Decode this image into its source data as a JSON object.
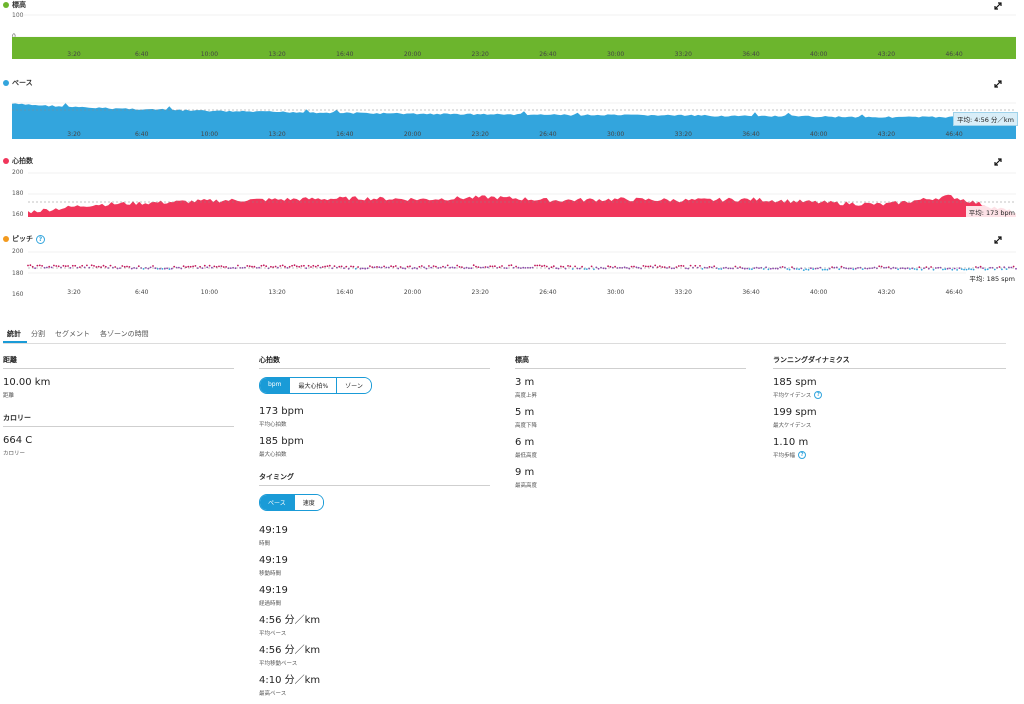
{
  "charts": {
    "elevation": {
      "title": "標高",
      "color": "#6cb52d",
      "yticks": [
        "100",
        "0"
      ]
    },
    "pace": {
      "title": "ペース",
      "color": "#33a5dd",
      "avg_label": "平均: 4:56 分／km"
    },
    "heart_rate": {
      "title": "心拍数",
      "color": "#f0365b",
      "yticks": [
        "200",
        "180",
        "160"
      ],
      "avg_label": "平均: 173 bpm"
    },
    "cadence": {
      "title": "ピッチ",
      "color": "#f39a1e",
      "help": "?",
      "yticks": [
        "200",
        "180",
        "160"
      ],
      "avg_label": "平均: 185 spm"
    },
    "x_ticks": [
      "3:20",
      "6:40",
      "10:00",
      "13:20",
      "16:40",
      "20:00",
      "23:20",
      "26:40",
      "30:00",
      "33:20",
      "36:40",
      "40:00",
      "43:20",
      "46:40"
    ]
  },
  "chart_data": [
    {
      "type": "area",
      "title": "標高",
      "x_unit": "elapsed time",
      "ylim": [
        0,
        100
      ],
      "series": [
        {
          "name": "標高",
          "values": [
            6,
            6,
            6,
            6,
            6,
            6,
            6,
            6,
            6,
            6,
            6,
            6,
            6,
            6,
            6
          ]
        }
      ]
    },
    {
      "type": "area",
      "title": "ペース",
      "average": "4:56 分／km",
      "series": [
        {
          "name": "ペース",
          "values": [
            4.7,
            4.8,
            4.85,
            4.9,
            4.92,
            4.95,
            4.97,
            4.98,
            5.0,
            5.0,
            5.02,
            5.03,
            5.05,
            5.05,
            5.06
          ]
        }
      ]
    },
    {
      "type": "area",
      "title": "心拍数",
      "ylim": [
        160,
        200
      ],
      "average": 173,
      "series": [
        {
          "name": "心拍数",
          "values": [
            163,
            170,
            172,
            174,
            175,
            176,
            175,
            177,
            174,
            175,
            174,
            175,
            172,
            170,
            178,
            162
          ]
        }
      ]
    },
    {
      "type": "scatter",
      "title": "ピッチ",
      "ylim": [
        160,
        200
      ],
      "average": 185,
      "series": [
        {
          "name": "ピッチ",
          "values": [
            186,
            186,
            185,
            186,
            186,
            185,
            186,
            186,
            185,
            186,
            185,
            184,
            185,
            184,
            185
          ]
        }
      ]
    }
  ],
  "tabs": [
    "統計",
    "分割",
    "セグメント",
    "各ゾーンの時間"
  ],
  "stats": {
    "distance": {
      "title": "距離",
      "value": "10.00 km",
      "label": "距離"
    },
    "calories": {
      "title": "カロリー",
      "value": "664 C",
      "label": "カロリー"
    },
    "heart": {
      "title": "心拍数",
      "toggle": [
        "bpm",
        "最大心拍%",
        "ゾーン"
      ],
      "items": [
        {
          "value": "173 bpm",
          "label": "平均心拍数"
        },
        {
          "value": "185 bpm",
          "label": "最大心拍数"
        }
      ]
    },
    "timing": {
      "title": "タイミング",
      "toggle": [
        "ペース",
        "速度"
      ],
      "items": [
        {
          "value": "49:19",
          "label": "時間"
        },
        {
          "value": "49:19",
          "label": "移動時間"
        },
        {
          "value": "49:19",
          "label": "経過時間"
        },
        {
          "value": "4:56 分／km",
          "label": "平均ペース"
        },
        {
          "value": "4:56 分／km",
          "label": "平均移動ペース"
        },
        {
          "value": "4:10 分／km",
          "label": "最高ペース"
        }
      ]
    },
    "elevation": {
      "title": "標高",
      "items": [
        {
          "value": "3 m",
          "label": "高度上昇"
        },
        {
          "value": "5 m",
          "label": "高度下降"
        },
        {
          "value": "6 m",
          "label": "最低高度"
        },
        {
          "value": "9 m",
          "label": "最高高度"
        }
      ]
    },
    "dynamics": {
      "title": "ランニングダイナミクス",
      "items": [
        {
          "value": "185 spm",
          "label": "平均ケイデンス",
          "help": "?"
        },
        {
          "value": "199 spm",
          "label": "最大ケイデンス"
        },
        {
          "value": "1.10 m",
          "label": "平均歩幅",
          "help": "?"
        }
      ]
    }
  }
}
